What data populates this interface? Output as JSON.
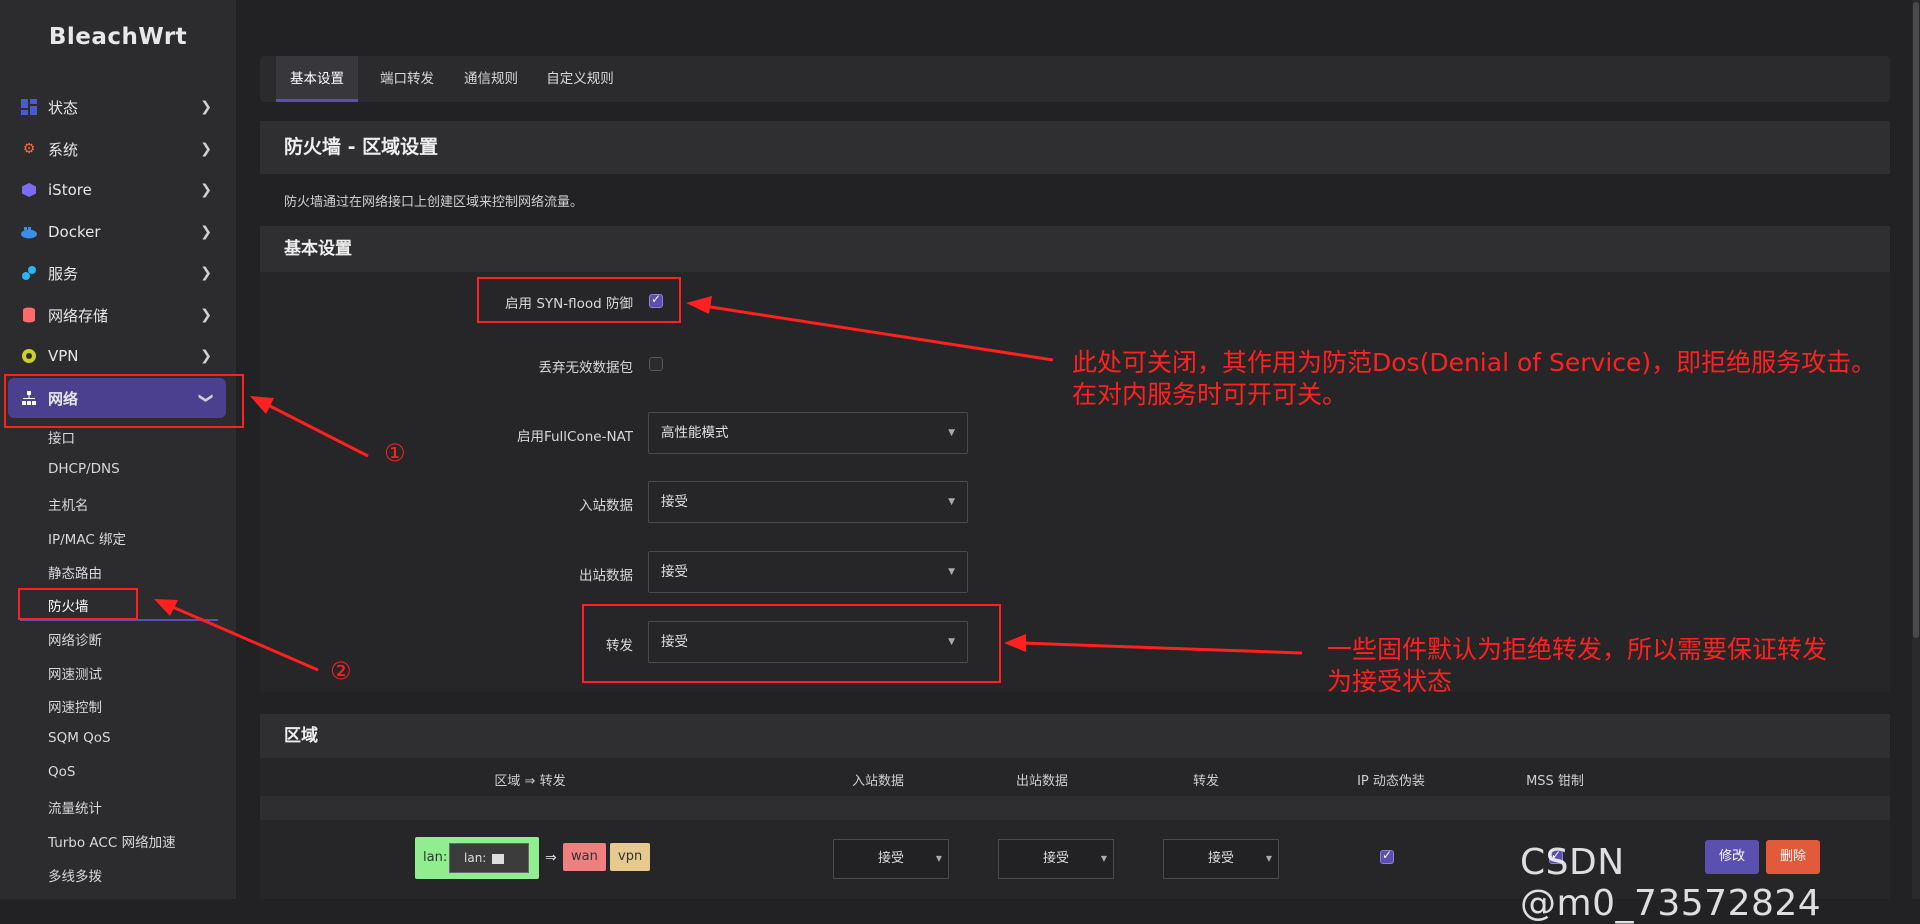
{
  "app": {
    "logo": "BleachWrt"
  },
  "sidebar": {
    "items": [
      {
        "label": "状态",
        "icon": "dashboard-icon",
        "color": "#4b5bcf"
      },
      {
        "label": "系统",
        "icon": "gear-icon",
        "color": "#ff6a3d"
      },
      {
        "label": "iStore",
        "icon": "cube-icon",
        "color": "#7b6cf0"
      },
      {
        "label": "Docker",
        "icon": "docker-whale-icon",
        "color": "#3a8ee6"
      },
      {
        "label": "服务",
        "icon": "puzzle-icon",
        "color": "#29b6f6"
      },
      {
        "label": "网络存储",
        "icon": "database-icon",
        "color": "#ff6b6b"
      },
      {
        "label": "VPN",
        "icon": "globe-icon",
        "color": "#c9d227"
      },
      {
        "label": "网络",
        "icon": "network-tree-icon",
        "color": "#ffffff"
      }
    ],
    "network_sub": [
      "接口",
      "DHCP/DNS",
      "主机名",
      "IP/MAC 绑定",
      "静态路由",
      "防火墙",
      "网络诊断",
      "网速测试",
      "网速控制",
      "SQM QoS",
      "QoS",
      "流量统计",
      "Turbo ACC 网络加速",
      "多线多拨"
    ]
  },
  "tabs": [
    "基本设置",
    "端口转发",
    "通信规则",
    "自定义规则"
  ],
  "page": {
    "title": "防火墙 - 区域设置",
    "description": "防火墙通过在网络接口上创建区域来控制网络流量。"
  },
  "basic": {
    "section_title": "基本设置",
    "syn_flood_label": "启用 SYN-flood 防御",
    "syn_flood_checked": true,
    "drop_invalid_label": "丢弃无效数据包",
    "drop_invalid_checked": false,
    "fullcone_label": "启用FullCone-NAT",
    "fullcone_value": "高性能模式",
    "input_label": "入站数据",
    "input_value": "接受",
    "output_label": "出站数据",
    "output_value": "接受",
    "forward_label": "转发",
    "forward_value": "接受"
  },
  "zones": {
    "section_title": "区域",
    "headers": [
      "区域 ⇒ 转发",
      "入站数据",
      "出站数据",
      "转发",
      "IP 动态伪装",
      "MSS 钳制"
    ],
    "row": {
      "zone_name": "lan:",
      "inner_label": "lan:",
      "arrow": "⇒",
      "targets": [
        "wan",
        "vpn"
      ],
      "input": "接受",
      "output": "接受",
      "forward": "接受",
      "masq": true,
      "mss": true,
      "edit_label": "修改",
      "delete_label": "删除"
    }
  },
  "annotations": {
    "marker1": "①",
    "marker2": "②",
    "syn_note_line1": "此处可关闭，其作用为防范Dos(Denial of Service)，即拒绝服务攻击。",
    "syn_note_line2": "在对内服务时可开可关。",
    "forward_note_line1": "一些固件默认为拒绝转发，所以需要保证转发",
    "forward_note_line2": "为接受状态"
  },
  "watermark": "CSDN @m0_73572824",
  "colors": {
    "accent": "#5b4fb0",
    "annotation_red": "#ff2020",
    "lan_zone": "#90ee90",
    "wan_zone": "#f08080",
    "vpn_zone": "#e6c98c",
    "edit_button": "#5b4fb0",
    "delete_button": "#e05a3b"
  }
}
